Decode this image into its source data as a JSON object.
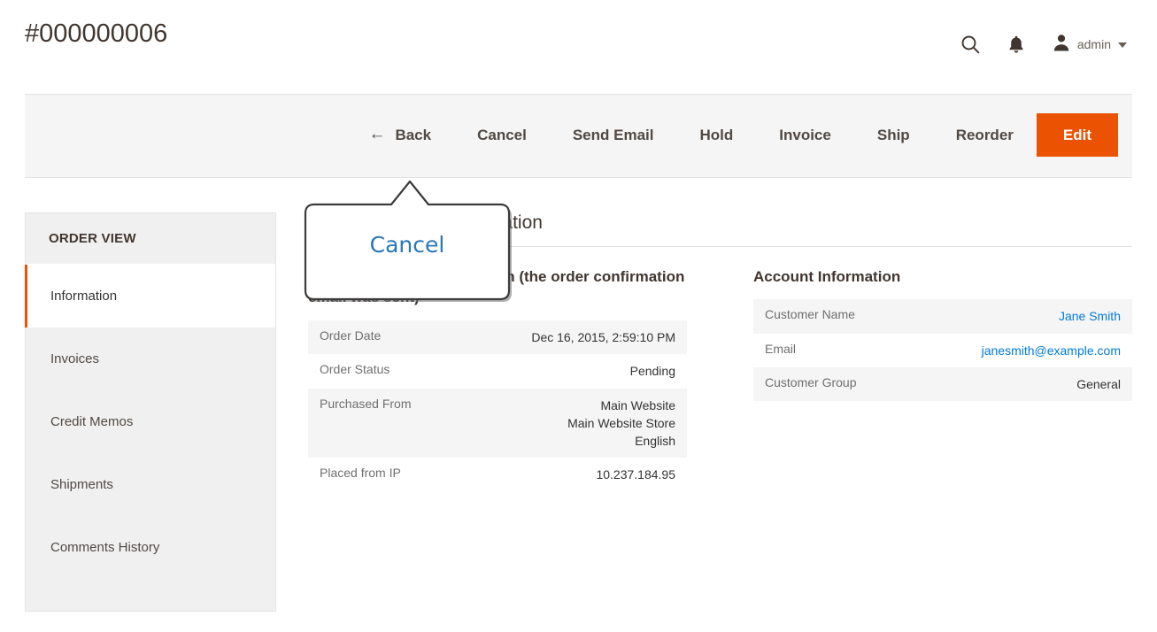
{
  "header": {
    "title": "#000000006",
    "search_icon": "search-icon",
    "notifications_icon": "bell-icon",
    "user_icon": "user-avatar-icon",
    "user_label": "admin",
    "caret_icon": "chevron-down-icon"
  },
  "toolbar": {
    "back_arrow": "←",
    "back_label": "Back",
    "cancel_label": "Cancel",
    "send_email_label": "Send Email",
    "hold_label": "Hold",
    "invoice_label": "Invoice",
    "ship_label": "Ship",
    "reorder_label": "Reorder",
    "edit_label": "Edit",
    "primary_color": "#eb5202"
  },
  "callout": {
    "label": "Cancel",
    "text_color": "#2b78b5"
  },
  "sidebar": {
    "title": "ORDER VIEW",
    "items": [
      {
        "label": "Information",
        "active": true
      },
      {
        "label": "Invoices",
        "active": false
      },
      {
        "label": "Credit Memos",
        "active": false
      },
      {
        "label": "Shipments",
        "active": false
      },
      {
        "label": "Comments History",
        "active": false
      }
    ],
    "active_marker_color": "#eb5202"
  },
  "main": {
    "page_heading": "Order & Account Information",
    "order_block": {
      "title": "Order & Account Information (the order confirmation email was sent)",
      "rows": [
        {
          "label": "Order Date",
          "value": "Dec 16, 2015, 2:59:10 PM",
          "link": false
        },
        {
          "label": "Order Status",
          "value": "Pending",
          "link": false
        },
        {
          "label": "Purchased From",
          "value": "Main Website\nMain Website Store\nEnglish",
          "link": false
        },
        {
          "label": "Placed from IP",
          "value": "10.237.184.95",
          "link": false
        }
      ]
    },
    "account_block": {
      "title": "Account Information",
      "rows": [
        {
          "label": "Customer Name",
          "value": "Jane Smith",
          "link": true
        },
        {
          "label": "Email",
          "value": "janesmith@example.com",
          "link": true
        },
        {
          "label": "Customer Group",
          "value": "General",
          "link": false
        }
      ]
    }
  }
}
